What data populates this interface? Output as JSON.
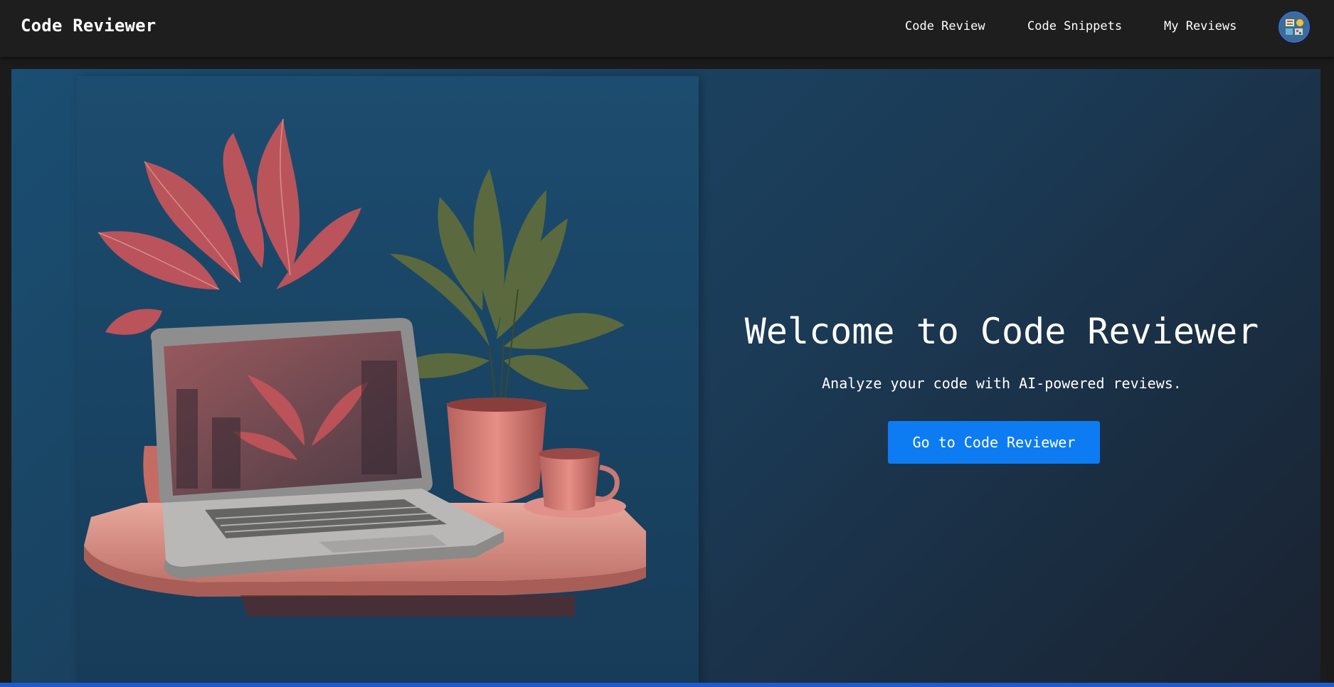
{
  "navbar": {
    "brand": "Code Reviewer",
    "links": [
      "Code Review",
      "Code Snippets",
      "My Reviews"
    ],
    "avatar_icon": "user-avatar-icon"
  },
  "hero": {
    "title": "Welcome to Code Reviewer",
    "subtitle": "Analyze your code with AI-powered reviews.",
    "cta_label": "Go to Code Reviewer",
    "image_icon": "laptop-with-plants-illustration"
  },
  "colors": {
    "navbar_bg": "#1e1e1e",
    "hero_gradient_start": "#1a4e72",
    "hero_gradient_end": "#1a2230",
    "accent": "#0d7cf2"
  }
}
